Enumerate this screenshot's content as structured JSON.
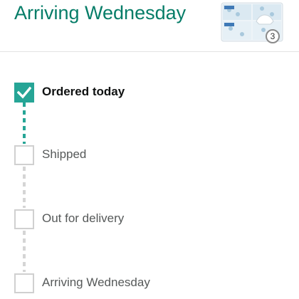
{
  "header": {
    "title": "Arriving Wednesday",
    "item_quantity": "3"
  },
  "tracker": {
    "steps": [
      {
        "label": "Ordered today",
        "completed": true
      },
      {
        "label": "Shipped",
        "completed": false
      },
      {
        "label": "Out for delivery",
        "completed": false
      },
      {
        "label": "Arriving Wednesday",
        "completed": false
      }
    ]
  },
  "colors": {
    "accent": "#26a596",
    "title": "#067d68",
    "inactive_text": "#565959"
  }
}
